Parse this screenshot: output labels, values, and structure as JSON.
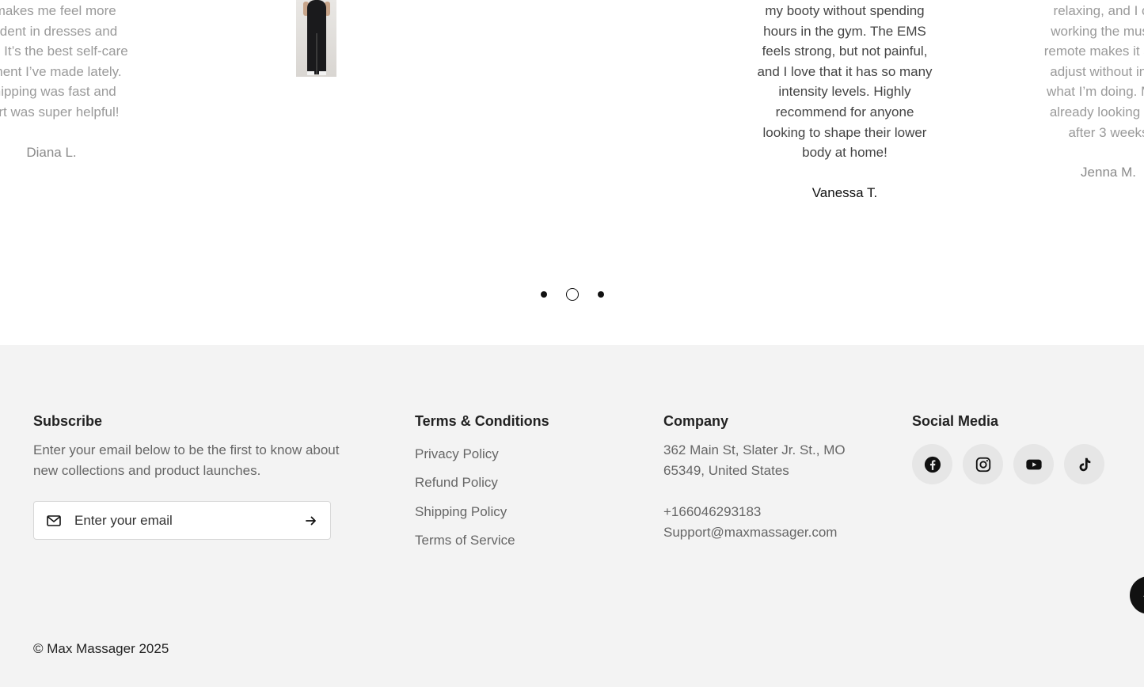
{
  "testimonials": {
    "left": {
      "quote": "I makes me feel more\nnfident in dresses and\nngs. It’s the best self-care\nstment I’ve made lately.\n shipping was fast and\nport was super helpful!",
      "author": "Diana L."
    },
    "center": {
      "quote": "my booty without spending\nhours in the gym. The EMS\nfeels strong, but not painful,\nand I love that it has so many\nintensity levels. Highly\nrecommend for anyone\nlooking to shape their lower\nbody at home!",
      "author": "Vanessa T."
    },
    "right": {
      "quote": "relaxing, and I can\nworking the muscle\nremote makes it supe\nadjust without interr\nwhat I’m doing. My g\nalready looking mor\nafter 3 weeks",
      "author": "Jenna M."
    },
    "pagination": {
      "count": 3,
      "active_index": 1
    }
  },
  "footer": {
    "subscribe": {
      "title": "Subscribe",
      "description": "Enter your email below to be the first to know about new collections and product launches.",
      "email_placeholder": "Enter your email"
    },
    "terms": {
      "title": "Terms & Conditions",
      "links": [
        "Privacy Policy",
        "Refund Policy",
        "Shipping Policy",
        "Terms of Service"
      ]
    },
    "company": {
      "title": "Company",
      "address": "362 Main St, Slater Jr. St., MO 65349, United States",
      "phone": "+166046293183",
      "email": "Support@maxmassager.com"
    },
    "social": {
      "title": "Social Media",
      "icons": [
        "facebook-icon",
        "instagram-icon",
        "youtube-icon",
        "tiktok-icon"
      ]
    },
    "copyright": "© Max Massager 2025"
  },
  "colors": {
    "footer_bg": "#f3f3f3",
    "text_dark": "#222222",
    "text_muted": "#666666",
    "faded": "#9a9a9a"
  }
}
